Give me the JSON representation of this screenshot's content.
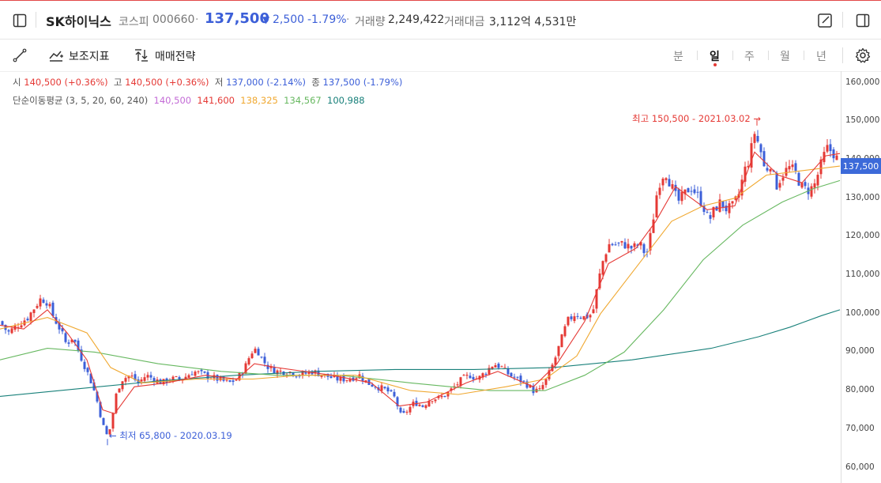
{
  "header": {
    "title": "SK하이닉스",
    "market": "코스피",
    "code": "000660",
    "dot": "·",
    "price": "137,500",
    "change_arrow": "▼",
    "change": "2,500",
    "change_pct": "-1.79%",
    "dot2": "·",
    "volume_label": "거래량",
    "volume": "2,249,422",
    "amount_label": "거래대금",
    "amount": "3,112억 4,531만"
  },
  "toolbar": {
    "indicators_label": "보조지표",
    "strategy_label": "매매전략",
    "periods": [
      "분",
      "일",
      "주",
      "월",
      "년"
    ],
    "active_period": "일"
  },
  "ohlc": {
    "open_label": "시",
    "open": "140,500 (+0.36%)",
    "high_label": "고",
    "high": "140,500 (+0.36%)",
    "low_label": "저",
    "low": "137,000 (-2.14%)",
    "close_label": "종",
    "close": "137,500 (-1.79%)"
  },
  "ma": {
    "label": "단순이동평균 (3, 5, 20, 60, 240)",
    "values": [
      "140,500",
      "141,600",
      "138,325",
      "134,567",
      "100,988"
    ],
    "colors": [
      "#c36bd6",
      "#e53935",
      "#f0a830",
      "#67b860",
      "#18807a"
    ]
  },
  "colors": {
    "up": "#e53935",
    "down": "#3c5fd8",
    "accent": "#3c6ad9"
  },
  "annotations": {
    "max": "최고 150,500 - 2021.03.02",
    "min": "최저 65,800 - 2020.03.19"
  },
  "current_price_tag": "137,500",
  "chart_data": {
    "type": "candlestick",
    "ylim": [
      56000,
      163000
    ],
    "y_ticks": [
      "160,000",
      "150,000",
      "140,000",
      "130,000",
      "120,000",
      "110,000",
      "100,000",
      "90,000",
      "80,000",
      "70,000",
      "60,000"
    ],
    "y_tick_values": [
      160000,
      150000,
      140000,
      130000,
      120000,
      110000,
      100000,
      90000,
      80000,
      70000,
      60000
    ],
    "close_path": [
      [
        0,
        98000
      ],
      [
        10,
        95000
      ],
      [
        22,
        97000
      ],
      [
        35,
        99000
      ],
      [
        45,
        102000
      ],
      [
        52,
        104000
      ],
      [
        60,
        103000
      ],
      [
        68,
        99000
      ],
      [
        76,
        96000
      ],
      [
        84,
        92000
      ],
      [
        92,
        94000
      ],
      [
        100,
        90000
      ],
      [
        108,
        86000
      ],
      [
        116,
        82000
      ],
      [
        122,
        78000
      ],
      [
        128,
        73000
      ],
      [
        133,
        69000
      ],
      [
        137,
        68000
      ],
      [
        142,
        73000
      ],
      [
        148,
        80000
      ],
      [
        155,
        83000
      ],
      [
        165,
        84000
      ],
      [
        175,
        82000
      ],
      [
        185,
        84000
      ],
      [
        195,
        83000
      ],
      [
        205,
        82000
      ],
      [
        215,
        83000
      ],
      [
        230,
        83000
      ],
      [
        245,
        85000
      ],
      [
        260,
        84000
      ],
      [
        275,
        83000
      ],
      [
        290,
        82000
      ],
      [
        300,
        83000
      ],
      [
        310,
        86000
      ],
      [
        318,
        90000
      ],
      [
        325,
        91000
      ],
      [
        332,
        88000
      ],
      [
        340,
        86000
      ],
      [
        350,
        85000
      ],
      [
        365,
        85000
      ],
      [
        380,
        84000
      ],
      [
        395,
        85000
      ],
      [
        410,
        84000
      ],
      [
        425,
        83000
      ],
      [
        440,
        83000
      ],
      [
        455,
        84000
      ],
      [
        465,
        82000
      ],
      [
        478,
        81000
      ],
      [
        490,
        80000
      ],
      [
        500,
        78000
      ],
      [
        508,
        73000
      ],
      [
        516,
        75000
      ],
      [
        525,
        77000
      ],
      [
        535,
        76000
      ],
      [
        545,
        78000
      ],
      [
        555,
        78000
      ],
      [
        565,
        79000
      ],
      [
        575,
        81000
      ],
      [
        585,
        83000
      ],
      [
        595,
        84000
      ],
      [
        605,
        83000
      ],
      [
        615,
        85000
      ],
      [
        625,
        87000
      ],
      [
        635,
        86000
      ],
      [
        645,
        84000
      ],
      [
        655,
        83000
      ],
      [
        665,
        82000
      ],
      [
        675,
        80000
      ],
      [
        683,
        80000
      ],
      [
        692,
        83000
      ],
      [
        702,
        88000
      ],
      [
        710,
        93000
      ],
      [
        718,
        98000
      ],
      [
        728,
        100000
      ],
      [
        740,
        99000
      ],
      [
        750,
        100000
      ],
      [
        756,
        107000
      ],
      [
        762,
        113000
      ],
      [
        770,
        118000
      ],
      [
        780,
        118000
      ],
      [
        790,
        118000
      ],
      [
        800,
        117000
      ],
      [
        810,
        118000
      ],
      [
        818,
        115000
      ],
      [
        825,
        122000
      ],
      [
        830,
        130000
      ],
      [
        836,
        135000
      ],
      [
        842,
        137000
      ],
      [
        850,
        133000
      ],
      [
        858,
        129000
      ],
      [
        866,
        131000
      ],
      [
        874,
        133000
      ],
      [
        882,
        131000
      ],
      [
        890,
        128000
      ],
      [
        897,
        124000
      ],
      [
        904,
        127000
      ],
      [
        912,
        129000
      ],
      [
        920,
        127000
      ],
      [
        928,
        128000
      ],
      [
        935,
        131000
      ],
      [
        942,
        137000
      ],
      [
        948,
        140000
      ],
      [
        955,
        147000
      ],
      [
        962,
        143000
      ],
      [
        968,
        137000
      ],
      [
        975,
        139000
      ],
      [
        982,
        133000
      ],
      [
        990,
        136000
      ],
      [
        998,
        138000
      ],
      [
        1006,
        137000
      ],
      [
        1014,
        133000
      ],
      [
        1022,
        132000
      ],
      [
        1030,
        133000
      ],
      [
        1038,
        138000
      ],
      [
        1046,
        143000
      ],
      [
        1054,
        142000
      ],
      [
        1060,
        140000
      ],
      [
        1063,
        137500
      ]
    ],
    "ma5_path": [
      [
        0,
        97000
      ],
      [
        30,
        96000
      ],
      [
        60,
        101000
      ],
      [
        85,
        95000
      ],
      [
        110,
        88000
      ],
      [
        130,
        75000
      ],
      [
        145,
        74000
      ],
      [
        170,
        81000
      ],
      [
        210,
        82000
      ],
      [
        260,
        84000
      ],
      [
        300,
        83000
      ],
      [
        322,
        87000
      ],
      [
        350,
        86000
      ],
      [
        420,
        84000
      ],
      [
        470,
        82000
      ],
      [
        505,
        76000
      ],
      [
        540,
        77000
      ],
      [
        590,
        82000
      ],
      [
        630,
        85000
      ],
      [
        675,
        81000
      ],
      [
        705,
        87000
      ],
      [
        740,
        98000
      ],
      [
        770,
        113000
      ],
      [
        805,
        117000
      ],
      [
        830,
        124000
      ],
      [
        855,
        133000
      ],
      [
        895,
        127000
      ],
      [
        930,
        128000
      ],
      [
        955,
        142000
      ],
      [
        985,
        136000
      ],
      [
        1015,
        134000
      ],
      [
        1045,
        141000
      ],
      [
        1063,
        141600
      ]
    ],
    "ma20_path": [
      [
        0,
        96000
      ],
      [
        60,
        99000
      ],
      [
        110,
        95000
      ],
      [
        140,
        86000
      ],
      [
        180,
        82000
      ],
      [
        250,
        83000
      ],
      [
        320,
        83000
      ],
      [
        380,
        84000
      ],
      [
        450,
        84000
      ],
      [
        520,
        80000
      ],
      [
        580,
        79000
      ],
      [
        640,
        81000
      ],
      [
        690,
        83000
      ],
      [
        730,
        89000
      ],
      [
        760,
        100000
      ],
      [
        790,
        108000
      ],
      [
        820,
        116000
      ],
      [
        850,
        124000
      ],
      [
        890,
        128000
      ],
      [
        930,
        130000
      ],
      [
        970,
        136000
      ],
      [
        1010,
        137000
      ],
      [
        1063,
        138325
      ]
    ],
    "ma60_path": [
      [
        0,
        88000
      ],
      [
        60,
        91000
      ],
      [
        120,
        90000
      ],
      [
        200,
        87000
      ],
      [
        280,
        85000
      ],
      [
        350,
        84000
      ],
      [
        430,
        84000
      ],
      [
        520,
        82000
      ],
      [
        620,
        80000
      ],
      [
        690,
        80000
      ],
      [
        740,
        84000
      ],
      [
        790,
        90000
      ],
      [
        840,
        101000
      ],
      [
        890,
        114000
      ],
      [
        940,
        123000
      ],
      [
        990,
        129000
      ],
      [
        1030,
        132500
      ],
      [
        1063,
        134567
      ]
    ],
    "ma240_path": [
      [
        0,
        78500
      ],
      [
        100,
        80500
      ],
      [
        200,
        82500
      ],
      [
        300,
        84000
      ],
      [
        400,
        85000
      ],
      [
        500,
        85500
      ],
      [
        600,
        85500
      ],
      [
        700,
        86000
      ],
      [
        800,
        88000
      ],
      [
        900,
        91000
      ],
      [
        960,
        94000
      ],
      [
        1000,
        96500
      ],
      [
        1040,
        99500
      ],
      [
        1063,
        100988
      ]
    ],
    "max_point": {
      "x": 958,
      "y": 150500
    },
    "min_point": {
      "x": 136,
      "y": 65800
    }
  }
}
